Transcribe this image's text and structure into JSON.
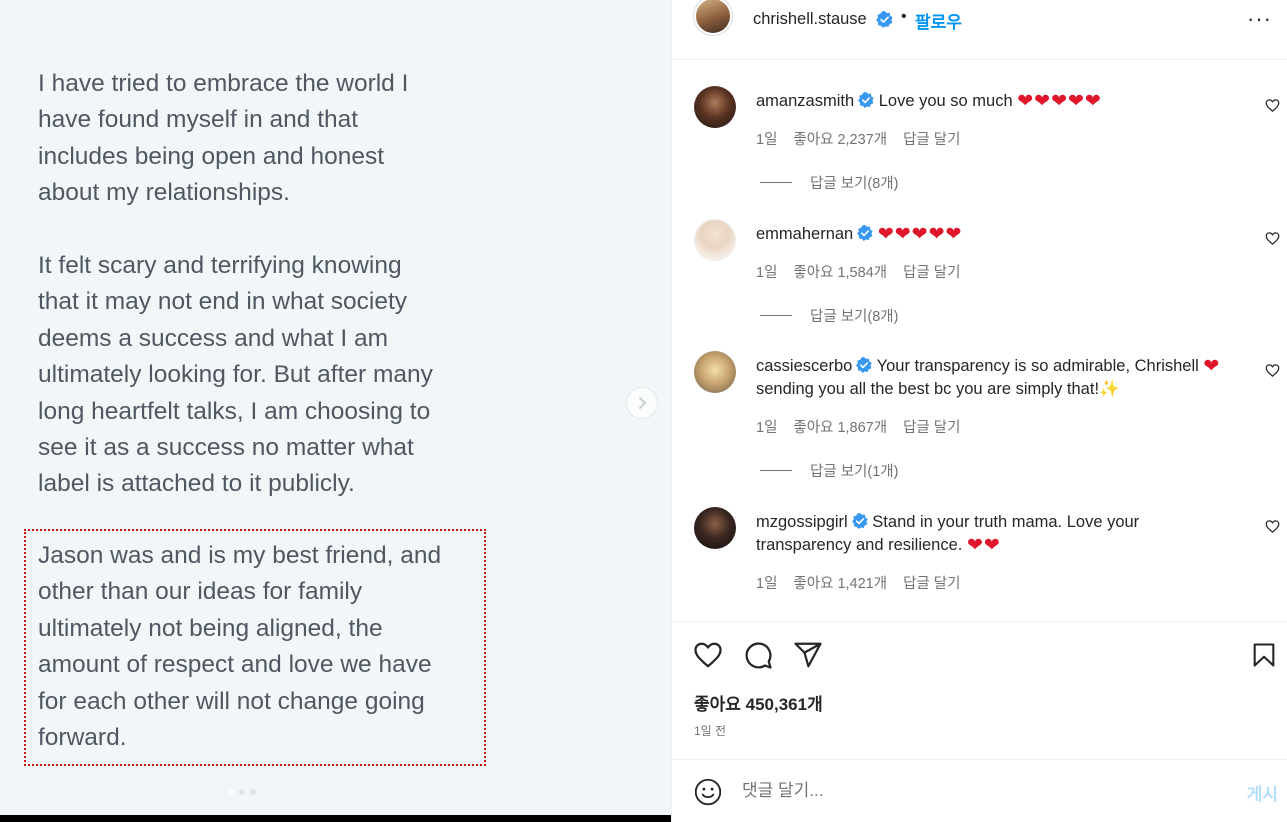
{
  "media": {
    "paragraphs": [
      "I have tried to embrace the world I\nhave found myself in and that\nincludes being open and honest\nabout my relationships.",
      "It felt scary and terrifying knowing\nthat it may not end in what society\ndeems a success and what I am\nultimately looking for.  But after many\nlong heartfelt talks, I am choosing to\nsee it as a success no matter what\nlabel is attached to it publicly.",
      "Jason was and is my best friend, and\nother than our ideas for family\nultimately not being aligned, the\namount of respect and love we have\nfor each other will not change going\nforward."
    ],
    "next_icon": "chevron-right-icon"
  },
  "header": {
    "username": "chrishell.stause",
    "bullet": "•",
    "follow_label": "팔로우",
    "more_label": "···"
  },
  "comments": [
    {
      "username": "amanzasmith",
      "text": "Love you so much",
      "hearts": "❤❤❤❤❤",
      "time": "1일",
      "likes": "좋아요 2,237개",
      "reply": "답글 달기",
      "view_replies": "답글 보기(8개)"
    },
    {
      "username": "emmahernan",
      "text": "",
      "hearts": "❤❤❤❤❤",
      "time": "1일",
      "likes": "좋아요 1,584개",
      "reply": "답글 달기",
      "view_replies": "답글 보기(8개)"
    },
    {
      "username": "cassiescerbo",
      "text": "Your transparency is so admirable, Chrishell",
      "hearts": "❤",
      "text2": "sending you all the best bc you are simply that!",
      "sparkle": "✨",
      "time": "1일",
      "likes": "좋아요 1,867개",
      "reply": "답글 달기",
      "view_replies": "답글 보기(1개)"
    },
    {
      "username": "mzgossipgirl",
      "text": "Stand in your truth mama. Love your transparency and resilience.",
      "hearts": "❤❤",
      "time": "1일",
      "likes": "좋아요 1,421개",
      "reply": "답글 달기"
    }
  ],
  "actions": {
    "likes": "좋아요 450,361개",
    "timestamp": "1일 전"
  },
  "comment_box": {
    "placeholder": "댓글 달기...",
    "post_label": "게시"
  },
  "colors": {
    "accent": "#0095f6",
    "heart": "#e0162b",
    "highlight": "#cc1111",
    "media_bg": "#f1f7f8"
  }
}
